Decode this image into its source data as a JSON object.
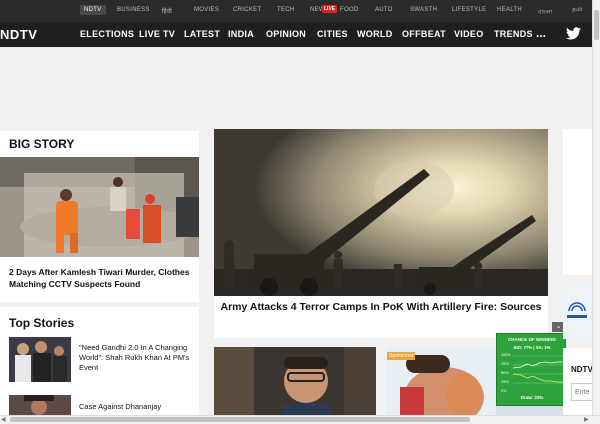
{
  "topbar": {
    "items": [
      "NDTV",
      "BUSINESS",
      "हिंदी",
      "MOVIES",
      "CRICKET",
      "TECH",
      "NEW",
      "FOOD",
      "AUTO",
      "SWASTH",
      "LIFESTYLE",
      "HEALTH",
      "বাংলা",
      "தமி"
    ],
    "live_badge": "LIVE"
  },
  "nav": {
    "logo": "NDTV",
    "items": [
      "ELECTIONS",
      "LIVE TV",
      "LATEST",
      "INDIA",
      "OPINION",
      "CITIES",
      "WORLD",
      "OFFBEAT",
      "VIDEO",
      "TRENDS"
    ],
    "more": "..."
  },
  "big_story": {
    "section_title": "BIG STORY",
    "headline": "2 Days After Kamlesh Tiwari Murder, Clothes Matching CCTV Suspects Found"
  },
  "hero": {
    "headline": "Army Attacks 4 Terror Camps In PoK With Artillery Fire: Sources"
  },
  "top_stories": {
    "section_title": "Top Stories",
    "items": [
      {
        "text": "\"Need Gandhi 2.0 In A Changing World\": Shah Rukh Khan At PM's Event"
      },
      {
        "text": "Case Against Dhananjay"
      }
    ]
  },
  "bottom": {
    "sponsored_label": "Sponsored"
  },
  "widget": {
    "title": "CHANCE OF WINNING",
    "teams": "IND: 77%  |  SA: 1%",
    "draw": "Draw: 22%",
    "y_labels": [
      "100%",
      "75%",
      "50%",
      "25%",
      "0%"
    ],
    "close": "⌄"
  },
  "right": {
    "ndtv": "NDTV",
    "email_placeholder": "Ente"
  },
  "colors": {
    "topbar_bg": "#2b2b2b",
    "nav_bg": "#1f1f1f",
    "live_red": "#e02020",
    "widget_green": "#2fa33b",
    "sponsored_orange": "#f0a23b"
  }
}
